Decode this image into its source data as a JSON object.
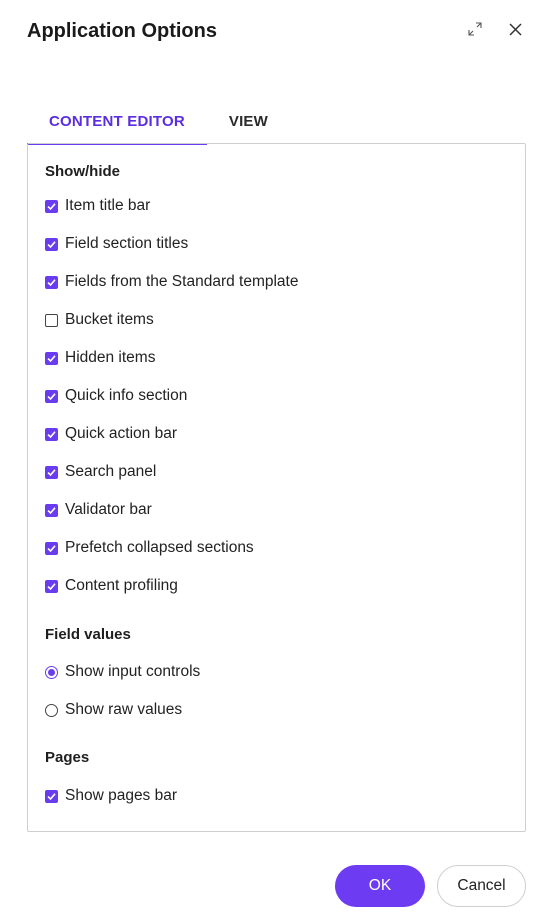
{
  "dialog": {
    "title": "Application Options",
    "expand_icon": "expand-icon",
    "close_icon": "close-icon"
  },
  "tabs": [
    {
      "label": "CONTENT EDITOR",
      "active": true
    },
    {
      "label": "VIEW",
      "active": false
    }
  ],
  "sections": {
    "show_hide": {
      "title": "Show/hide",
      "items": [
        {
          "label": "Item title bar",
          "checked": true
        },
        {
          "label": "Field section titles",
          "checked": true
        },
        {
          "label": "Fields from the Standard template",
          "checked": true
        },
        {
          "label": "Bucket items",
          "checked": false
        },
        {
          "label": "Hidden items",
          "checked": true
        },
        {
          "label": "Quick info section",
          "checked": true
        },
        {
          "label": "Quick action bar",
          "checked": true
        },
        {
          "label": "Search panel",
          "checked": true
        },
        {
          "label": "Validator bar",
          "checked": true
        },
        {
          "label": "Prefetch collapsed sections",
          "checked": true
        },
        {
          "label": "Content profiling",
          "checked": true
        }
      ]
    },
    "field_values": {
      "title": "Field values",
      "options": [
        {
          "label": "Show input controls",
          "selected": true
        },
        {
          "label": "Show raw values",
          "selected": false
        }
      ]
    },
    "pages": {
      "title": "Pages",
      "items": [
        {
          "label": "Show pages bar",
          "checked": true
        }
      ]
    }
  },
  "footer": {
    "ok_label": "OK",
    "cancel_label": "Cancel"
  },
  "colors": {
    "accent": "#6a3cf0",
    "tab_active_text": "#5b2de0"
  }
}
